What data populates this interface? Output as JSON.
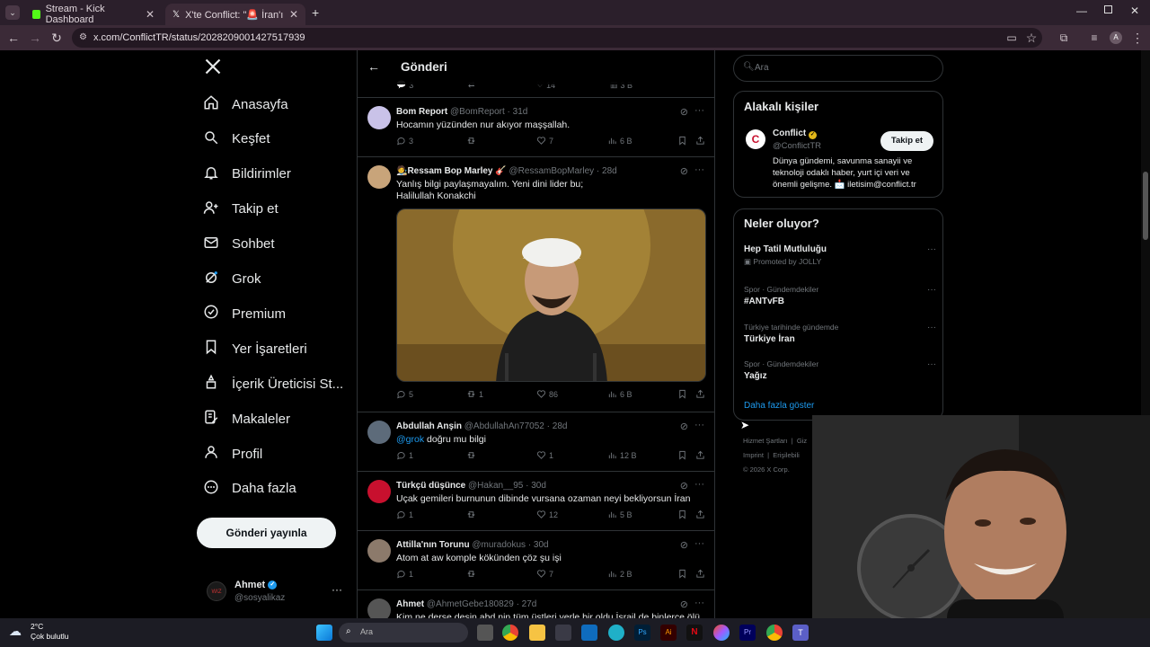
{
  "browser": {
    "tabs": [
      {
        "title": "Stream - Kick Dashboard"
      },
      {
        "title": "X'te Conflict: \"🚨 İran'ın yeni di"
      }
    ],
    "url": "x.com/ConflictTR/status/2028209001427517939"
  },
  "left_nav": {
    "items": [
      {
        "label": "Anasayfa",
        "icon": "home-icon"
      },
      {
        "label": "Keşfet",
        "icon": "search-icon"
      },
      {
        "label": "Bildirimler",
        "icon": "bell-icon"
      },
      {
        "label": "Takip et",
        "icon": "follow-icon"
      },
      {
        "label": "Sohbet",
        "icon": "mail-icon"
      },
      {
        "label": "Grok",
        "icon": "grok-icon"
      },
      {
        "label": "Premium",
        "icon": "premium-icon"
      },
      {
        "label": "Yer İşaretleri",
        "icon": "bookmark-icon"
      },
      {
        "label": "İçerik Üreticisi St...",
        "icon": "creator-icon"
      },
      {
        "label": "Makaleler",
        "icon": "articles-icon"
      },
      {
        "label": "Profil",
        "icon": "profile-icon"
      },
      {
        "label": "Daha fazla",
        "icon": "more-icon"
      }
    ],
    "post_button": "Gönderi yayınla",
    "profile": {
      "name": "Ahmet",
      "handle": "@sosyalikaz",
      "more": "···"
    }
  },
  "center": {
    "header_title": "Gönderi",
    "top_partial_counts": {
      "replies": "3",
      "reposts": "",
      "likes": "14",
      "views": "3 B"
    },
    "tweets": [
      {
        "name": "Bom Report",
        "handle": "@BomReport",
        "time": "· 31d",
        "text": [
          "Hocamın yüzünden nur akıyor maşşallah."
        ],
        "replies": "3",
        "reposts": "",
        "likes": "7",
        "views": "6 B"
      },
      {
        "name": "🧑‍🎨Ressam Bop Marley 🎸",
        "handle": "@RessamBopMarley",
        "time": "· 28d",
        "text": [
          "Yanlış bilgi paylaşmayalım. Yeni dini lider bu;",
          "Halilullah Konakchi"
        ],
        "replies": "5",
        "reposts": "1",
        "likes": "86",
        "views": "6 B"
      },
      {
        "name": "Abdullah Anşin",
        "handle": "@AbdullahAn77052",
        "time": "· 28d",
        "mention": "@grok",
        "text": [
          " doğru mu bilgi"
        ],
        "replies": "1",
        "reposts": "",
        "likes": "1",
        "views": "12 B"
      },
      {
        "name": "Türkçü düşünce",
        "handle": "@Hakan__95",
        "time": "· 30d",
        "text": [
          "Uçak gemileri burnunun dibinde vursana ozaman neyi bekliyorsun İran"
        ],
        "replies": "1",
        "reposts": "",
        "likes": "12",
        "views": "5 B"
      },
      {
        "name": "Attilla'nın Torunu",
        "handle": "@muradokus",
        "time": "· 30d",
        "text": [
          "Atom at aw komple kökünden çöz şu işi"
        ],
        "replies": "1",
        "reposts": "",
        "likes": "7",
        "views": "2 B"
      },
      {
        "name": "Ahmet",
        "handle": "@AhmetGebe180829",
        "time": "· 27d",
        "text": [
          "Kim ne derse desin abd nin tüm üstleri yerle bir oldu İsrail de binlerce ölü"
        ],
        "replies": "",
        "reposts": "",
        "likes": "",
        "views": ""
      }
    ]
  },
  "right": {
    "search_placeholder": "Ara",
    "related": {
      "title": "Alakalı kişiler",
      "name": "Conflict",
      "handle": "@ConflictTR",
      "follow": "Takip et",
      "bio": [
        "Dünya gündemi, savunma sanayii ve",
        "teknoloji odaklı haber, yurt içi veri ve",
        "önemli gelişme. 📩 iletisim@conflict.tr"
      ]
    },
    "trends": {
      "title": "Neler oluyor?",
      "items": [
        {
          "meta": "",
          "name": "Hep Tatil Mutluluğu",
          "sub": "Promoted by JOLLY"
        },
        {
          "meta": "Spor · Gündemdekiler",
          "name": "#ANTvFB",
          "sub": ""
        },
        {
          "meta": "Türkiye tarihinde gündemde",
          "name": "Türkiye İran",
          "sub": ""
        },
        {
          "meta": "Spor · Gündemdekiler",
          "name": "Yağız",
          "sub": ""
        }
      ],
      "show_more": "Daha fazla göster"
    },
    "footer": [
      "Hizmet Şartları",
      "|",
      "Giz",
      "Imprint",
      "|",
      "Erişilebili",
      "© 2026 X Corp."
    ]
  },
  "taskbar": {
    "weather_temp": "2°C",
    "weather_desc": "Çok bulutlu",
    "search_placeholder": "Ara"
  },
  "colors": {
    "accent": "#1d9bf0",
    "bg": "#000000",
    "border": "#2f3336",
    "muted": "#71767b"
  }
}
